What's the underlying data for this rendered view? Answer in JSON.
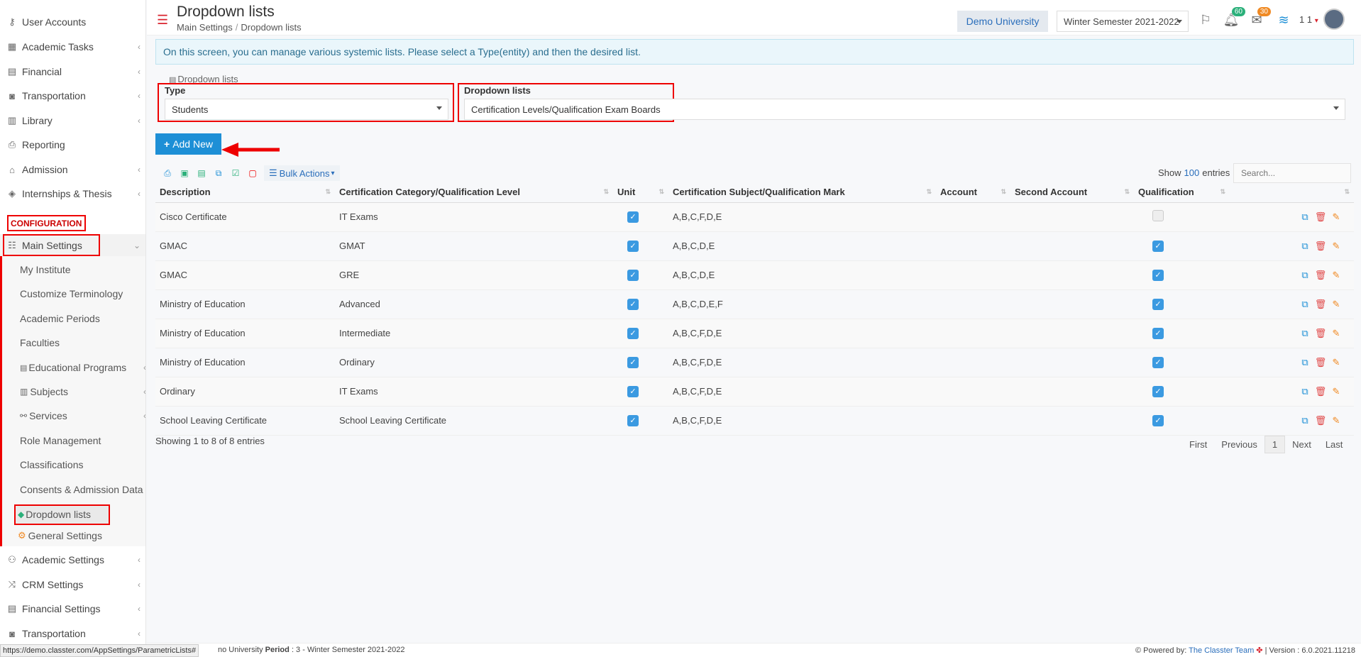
{
  "sidebar": {
    "top_items": [
      {
        "label": "User Accounts",
        "icon": "key-icon"
      },
      {
        "label": "Academic Tasks",
        "icon": "grid-icon"
      },
      {
        "label": "Financial",
        "icon": "money-icon"
      },
      {
        "label": "Transportation",
        "icon": "bus-icon"
      },
      {
        "label": "Library",
        "icon": "book-icon"
      },
      {
        "label": "Reporting",
        "icon": "printer-icon"
      },
      {
        "label": "Admission",
        "icon": "bank-icon"
      },
      {
        "label": "Internships & Thesis",
        "icon": "cube-icon"
      }
    ],
    "config_label": "CONFIGURATION",
    "main_settings": "Main Settings",
    "sub_items": [
      "My Institute",
      "Customize Terminology",
      "Academic Periods",
      "Faculties",
      "Educational Programs",
      "Subjects",
      "Services",
      "Role Management",
      "Classifications",
      "Consents & Admission Data",
      "Dropdown lists",
      "General Settings"
    ],
    "bottom_items": [
      "Academic Settings",
      "CRM Settings",
      "Financial Settings",
      "Transportation"
    ]
  },
  "header": {
    "title": "Dropdown lists",
    "breadcrumb": [
      "Main Settings",
      "Dropdown lists"
    ],
    "university": "Demo University",
    "semester": "Winter Semester 2021-2022",
    "notif_count": "60",
    "mail_count": "30",
    "user_text": "1 1"
  },
  "info_text": "On this screen, you can manage various systemic lists. Please select a Type(entity) and then the desired list.",
  "panel_label": "Dropdown lists",
  "form": {
    "type_label": "Type",
    "type_value": "Students",
    "list_label": "Dropdown lists",
    "list_value": "Certification Levels/Qualification Exam Boards"
  },
  "add_new": "Add New",
  "bulk_actions": "Bulk Actions",
  "show": {
    "prefix": "Show",
    "count": "100",
    "suffix": "entries"
  },
  "search_placeholder": "Search...",
  "table": {
    "headers": [
      "Description",
      "Certification Category/Qualification Level",
      "Unit",
      "Certification Subject/Qualification Mark",
      "Account",
      "Second Account",
      "Qualification"
    ],
    "rows": [
      {
        "desc": "Cisco Certificate",
        "cat": "IT Exams",
        "unit": true,
        "mark": "A,B,C,F,D,E",
        "qual": false
      },
      {
        "desc": "GMAC",
        "cat": "GMAT",
        "unit": true,
        "mark": "A,B,C,D,E",
        "qual": true
      },
      {
        "desc": "GMAC",
        "cat": "GRE",
        "unit": true,
        "mark": "A,B,C,D,E",
        "qual": true
      },
      {
        "desc": "Ministry of Education",
        "cat": "Advanced",
        "unit": true,
        "mark": "A,B,C,D,E,F",
        "qual": true
      },
      {
        "desc": "Ministry of Education",
        "cat": "Intermediate",
        "unit": true,
        "mark": "A,B,C,F,D,E",
        "qual": true
      },
      {
        "desc": "Ministry of Education",
        "cat": "Ordinary",
        "unit": true,
        "mark": "A,B,C,F,D,E",
        "qual": true
      },
      {
        "desc": "Ordinary",
        "cat": "IT Exams",
        "unit": true,
        "mark": "A,B,C,F,D,E",
        "qual": true
      },
      {
        "desc": "School Leaving Certificate",
        "cat": "School Leaving Certificate",
        "unit": true,
        "mark": "A,B,C,F,D,E",
        "qual": true
      }
    ]
  },
  "showing_text": "Showing 1 to 8 of 8 entries",
  "pager": {
    "first": "First",
    "previous": "Previous",
    "current": "1",
    "next": "Next",
    "last": "Last"
  },
  "footer": {
    "left_text": "no University",
    "period_label": "Period",
    "period_value": ": 3 - Winter Semester 2021-2022",
    "powered_by": "Powered by:",
    "team": "The Classter Team",
    "version": "| Version : 6.0.2021.11218"
  },
  "status_url": "https://demo.classter.com/AppSettings/ParametricLists#",
  "colors": {
    "accent": "#1d8fd6",
    "highlight": "#e00000",
    "brand_red": "#d9232d"
  }
}
